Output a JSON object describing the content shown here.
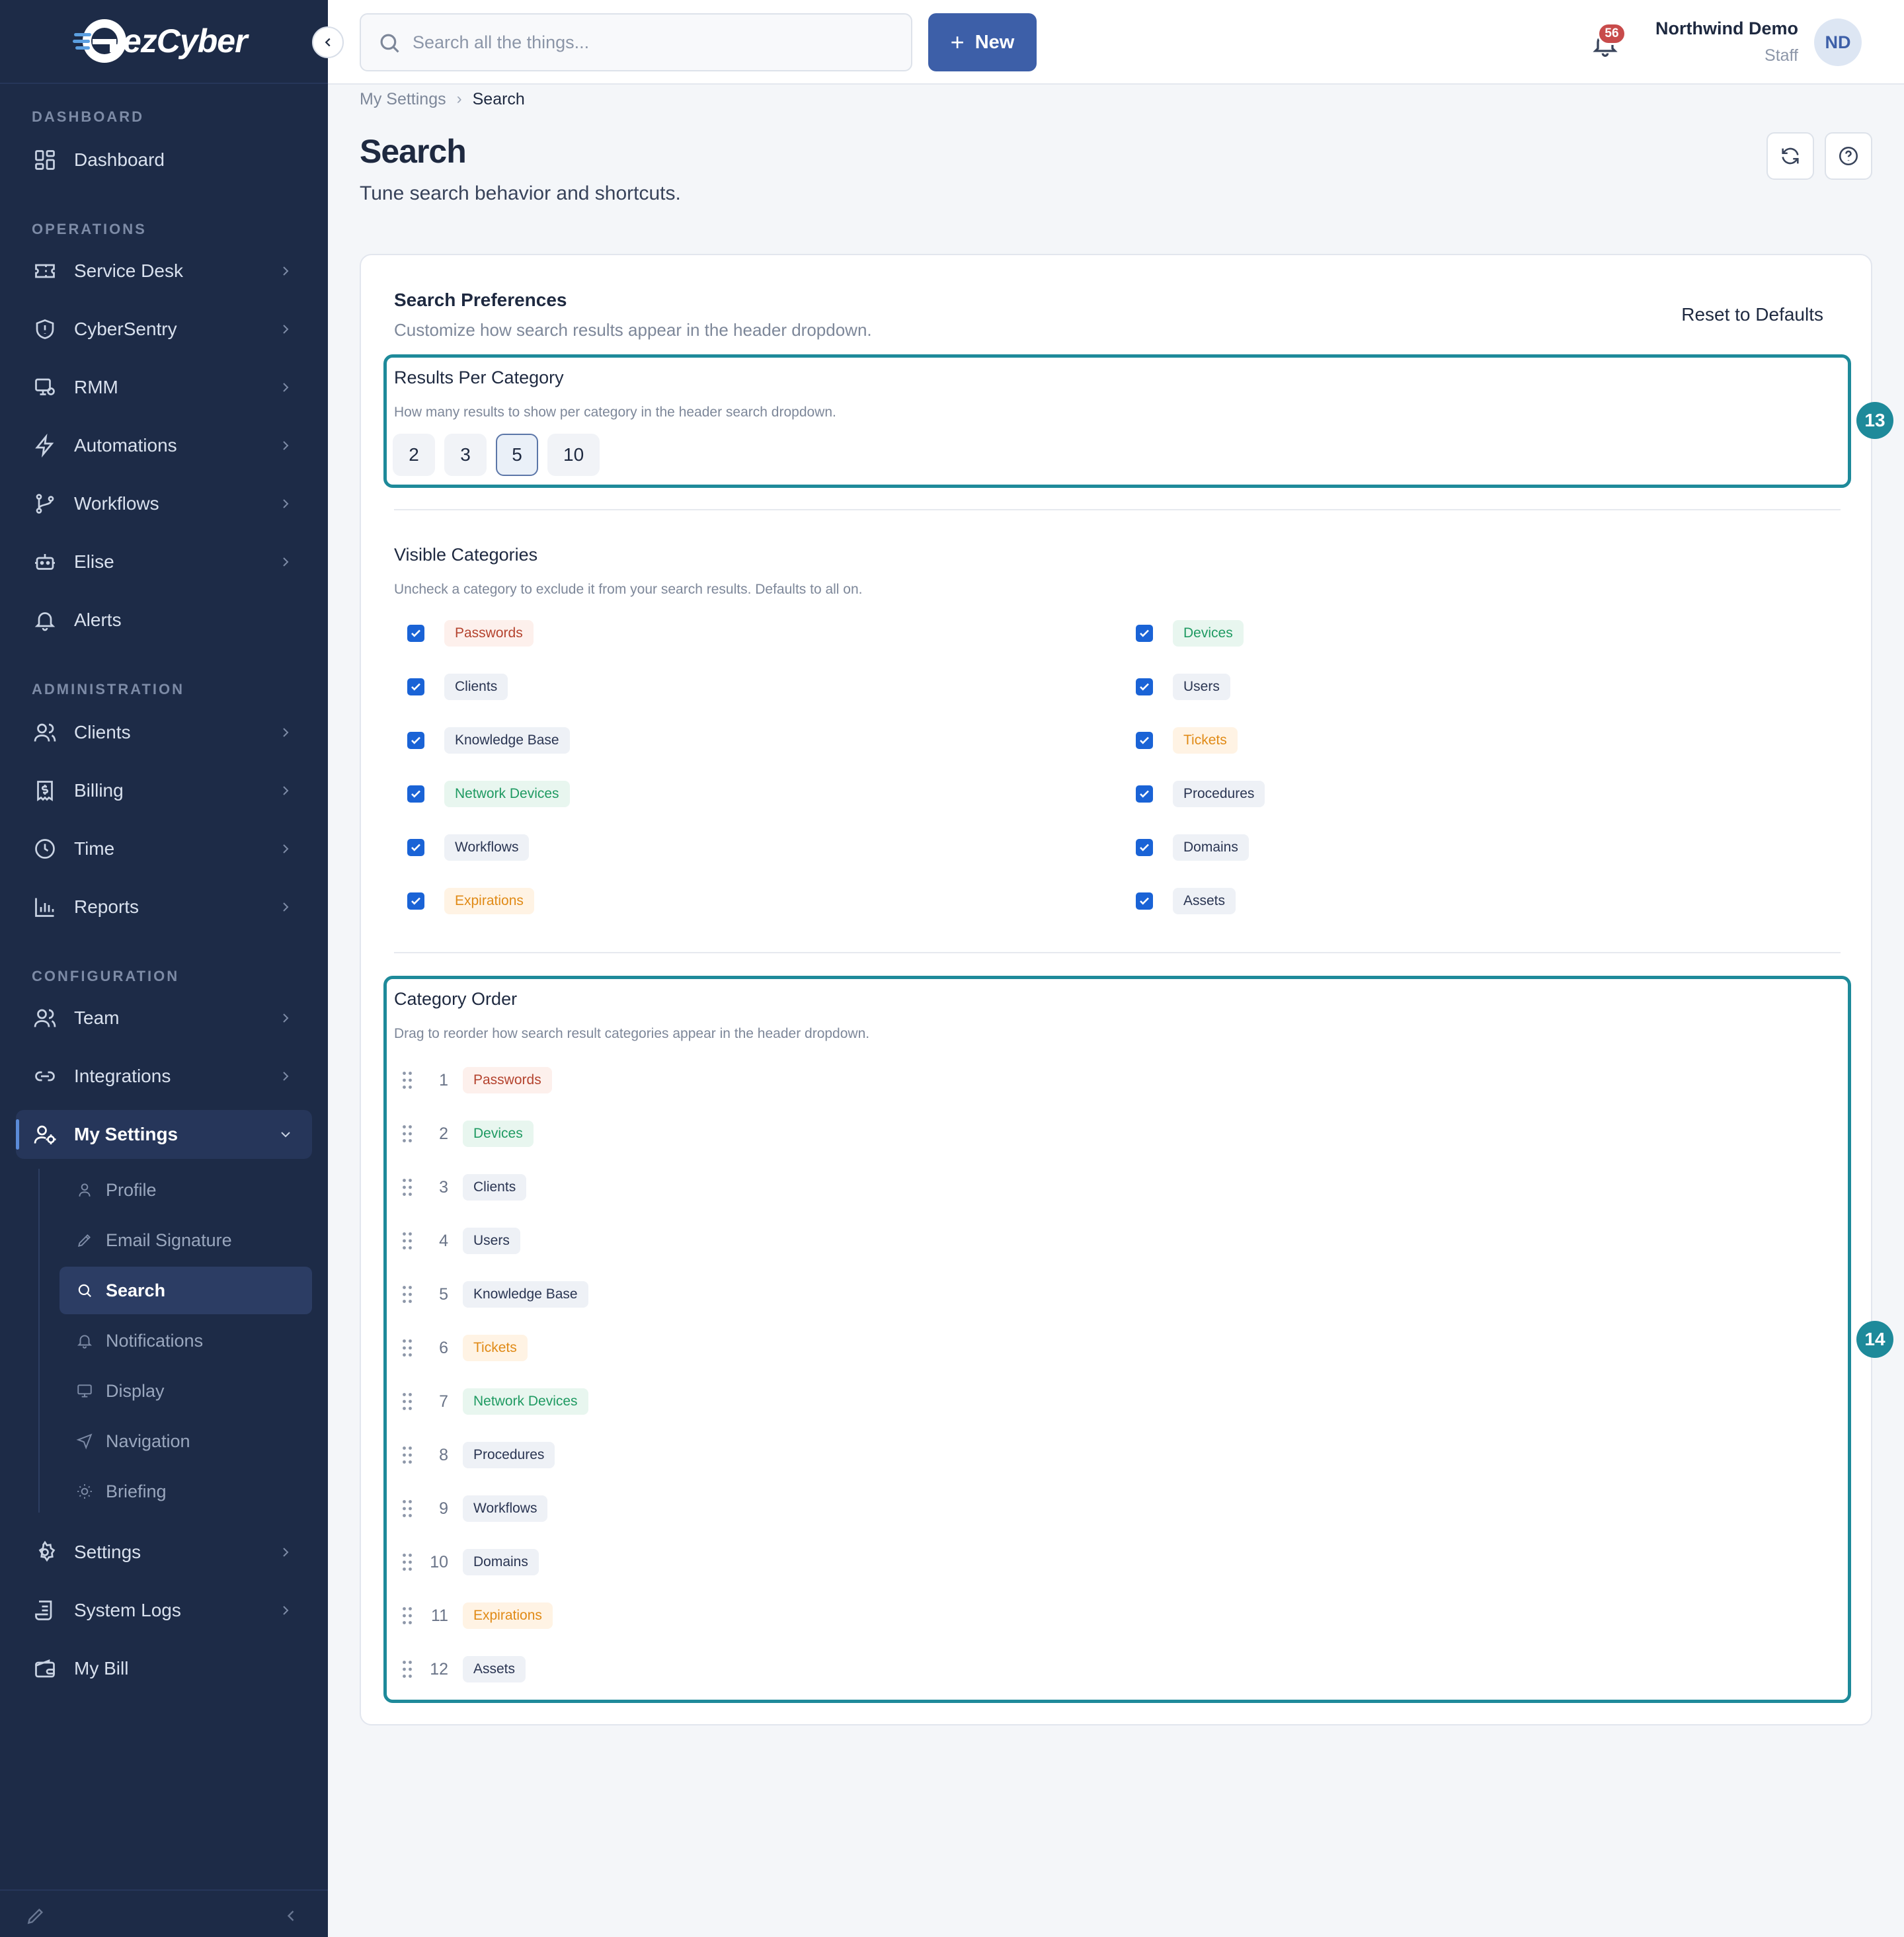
{
  "brand": {
    "logo_text": "ezCyber"
  },
  "colors": {
    "sidebar_bg": "#1d2b47",
    "primary": "#3d5fa8",
    "highlight": "#1e8a9a",
    "checkbox": "#1a63d6"
  },
  "sidebar": {
    "sections": {
      "dashboard": "DASHBOARD",
      "operations": "OPERATIONS",
      "administration": "ADMINISTRATION",
      "configuration": "CONFIGURATION"
    },
    "items": {
      "dashboard": "Dashboard",
      "service_desk": "Service Desk",
      "cybersentry": "CyberSentry",
      "rmm": "RMM",
      "automations": "Automations",
      "workflows": "Workflows",
      "elise": "Elise",
      "alerts": "Alerts",
      "clients": "Clients",
      "billing": "Billing",
      "time": "Time",
      "reports": "Reports",
      "team": "Team",
      "integrations": "Integrations",
      "my_settings": "My Settings",
      "settings": "Settings",
      "system_logs": "System Logs",
      "my_bill": "My Bill"
    },
    "sub_items": {
      "profile": "Profile",
      "email_signature": "Email Signature",
      "search": "Search",
      "notifications": "Notifications",
      "display": "Display",
      "navigation": "Navigation",
      "briefing": "Briefing"
    }
  },
  "header": {
    "search_placeholder": "Search all the things...",
    "new_label": "New",
    "notification_count": "56",
    "user_name": "Northwind Demo",
    "user_role": "Staff",
    "avatar_initials": "ND"
  },
  "breadcrumb": {
    "parent": "My Settings",
    "current": "Search"
  },
  "page": {
    "title": "Search",
    "subtitle": "Tune search behavior and shortcuts."
  },
  "card": {
    "title": "Search Preferences",
    "subtitle": "Customize how search results appear in the header dropdown.",
    "reset_label": "Reset to Defaults",
    "results_per_category": {
      "title": "Results Per Category",
      "description": "How many results to show per category in the header search dropdown.",
      "options": [
        "2",
        "3",
        "5",
        "10"
      ],
      "selected": "5",
      "marker": "13"
    },
    "visible_categories": {
      "title": "Visible Categories",
      "description": "Uncheck a category to exclude it from your search results. Defaults to all on.",
      "left": [
        {
          "label": "Passwords",
          "checked": true,
          "color": "red"
        },
        {
          "label": "Clients",
          "checked": true,
          "color": "slate"
        },
        {
          "label": "Knowledge Base",
          "checked": true,
          "color": "slate"
        },
        {
          "label": "Network Devices",
          "checked": true,
          "color": "green"
        },
        {
          "label": "Workflows",
          "checked": true,
          "color": "slate"
        },
        {
          "label": "Expirations",
          "checked": true,
          "color": "orange"
        }
      ],
      "right": [
        {
          "label": "Devices",
          "checked": true,
          "color": "green"
        },
        {
          "label": "Users",
          "checked": true,
          "color": "slate"
        },
        {
          "label": "Tickets",
          "checked": true,
          "color": "orange"
        },
        {
          "label": "Procedures",
          "checked": true,
          "color": "slate"
        },
        {
          "label": "Domains",
          "checked": true,
          "color": "slate"
        },
        {
          "label": "Assets",
          "checked": true,
          "color": "slate"
        }
      ]
    },
    "category_order": {
      "title": "Category Order",
      "description": "Drag to reorder how search result categories appear in the header dropdown.",
      "marker": "14",
      "items": [
        {
          "num": "1",
          "label": "Passwords",
          "color": "red"
        },
        {
          "num": "2",
          "label": "Devices",
          "color": "green"
        },
        {
          "num": "3",
          "label": "Clients",
          "color": "slate"
        },
        {
          "num": "4",
          "label": "Users",
          "color": "slate"
        },
        {
          "num": "5",
          "label": "Knowledge Base",
          "color": "slate"
        },
        {
          "num": "6",
          "label": "Tickets",
          "color": "orange"
        },
        {
          "num": "7",
          "label": "Network Devices",
          "color": "green"
        },
        {
          "num": "8",
          "label": "Procedures",
          "color": "slate"
        },
        {
          "num": "9",
          "label": "Workflows",
          "color": "slate"
        },
        {
          "num": "10",
          "label": "Domains",
          "color": "slate"
        },
        {
          "num": "11",
          "label": "Expirations",
          "color": "orange"
        },
        {
          "num": "12",
          "label": "Assets",
          "color": "slate"
        }
      ]
    }
  }
}
